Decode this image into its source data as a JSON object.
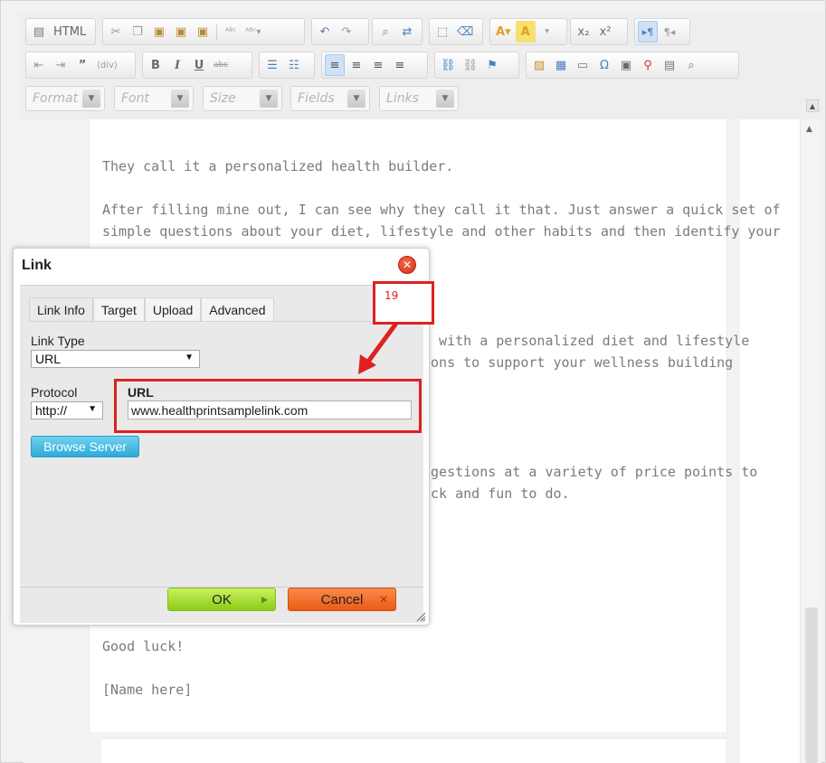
{
  "toolbar": {
    "html_label": "HTML",
    "subscript_label": "x₂",
    "superscript_label": "x²",
    "bold_label": "B",
    "italic_label": "I",
    "underline_label": "U",
    "strike_label": "abc",
    "quote_label": "”",
    "omega_label": "Ω"
  },
  "combos": {
    "format": "Format",
    "font": "Font",
    "size": "Size",
    "fields": "Fields",
    "links": "Links"
  },
  "editor": {
    "p1": "They call it a personalized health builder.",
    "p2_line1": "After filling mine out, I can see why they call it that. Just answer a quick set of",
    "p2_line2": "simple questions about your diet, lifestyle and other habits and then identify your",
    "p3_line1": "u with a personalized diet and lifestyle",
    "p3_line2": "ions to support your wellness building",
    "p4_line1": "ggestions at a variety of price points to",
    "p4_line2": "ick and fun to do.",
    "p5": "Good luck!",
    "p6": "[Name here]"
  },
  "dialog": {
    "title": "Link",
    "tabs": [
      "Link Info",
      "Target",
      "Upload",
      "Advanced"
    ],
    "link_type_label": "Link Type",
    "link_type_value": "URL",
    "protocol_label": "Protocol",
    "protocol_value": "http://",
    "url_label": "URL",
    "url_value": "www.healthprintsamplelink.com",
    "browse_label": "Browse Server",
    "ok_label": "OK",
    "cancel_label": "Cancel"
  },
  "annotation": {
    "step_number": "19",
    "color": "#e02020"
  },
  "colors": {
    "ok_green": "#9cd428",
    "cancel_orange": "#f26a24",
    "browse_blue": "#3fb5e0",
    "close_red": "#e0401e"
  }
}
